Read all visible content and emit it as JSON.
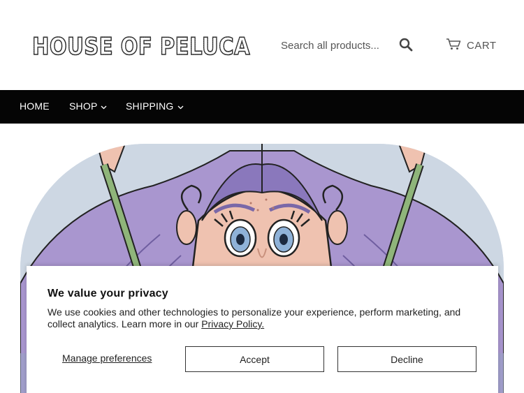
{
  "header": {
    "logo_text": "HOUSE OF PELUCA",
    "search": {
      "placeholder": "Search all products..."
    },
    "cart_label": "CART",
    "icons": {
      "search": "search-icon",
      "cart": "cart-icon"
    }
  },
  "nav": {
    "items": [
      {
        "label": "HOME",
        "has_dropdown": false
      },
      {
        "label": "SHOP",
        "has_dropdown": true
      },
      {
        "label": "SHIPPING",
        "has_dropdown": true
      }
    ]
  },
  "hero": {
    "image": "illustration of a character with long lavender hair and blue eyes",
    "colors": {
      "background": "#cdd7e3",
      "hair": "#a996cf",
      "hair_dark": "#7a68a8",
      "skin": "#efc2b0",
      "eyes": "#8fb2d8",
      "stems": "#8fb57a"
    }
  },
  "cookie_banner": {
    "title": "We value your privacy",
    "text": "We use cookies and other technologies to personalize your experience, perform marketing, and collect analytics. Learn more in our ",
    "link_label": "Privacy Policy.",
    "manage_label": "Manage preferences",
    "accept_label": "Accept",
    "decline_label": "Decline"
  },
  "colors": {
    "nav_bg": "#050505",
    "nav_text": "#ffffff",
    "text": "#222222"
  }
}
